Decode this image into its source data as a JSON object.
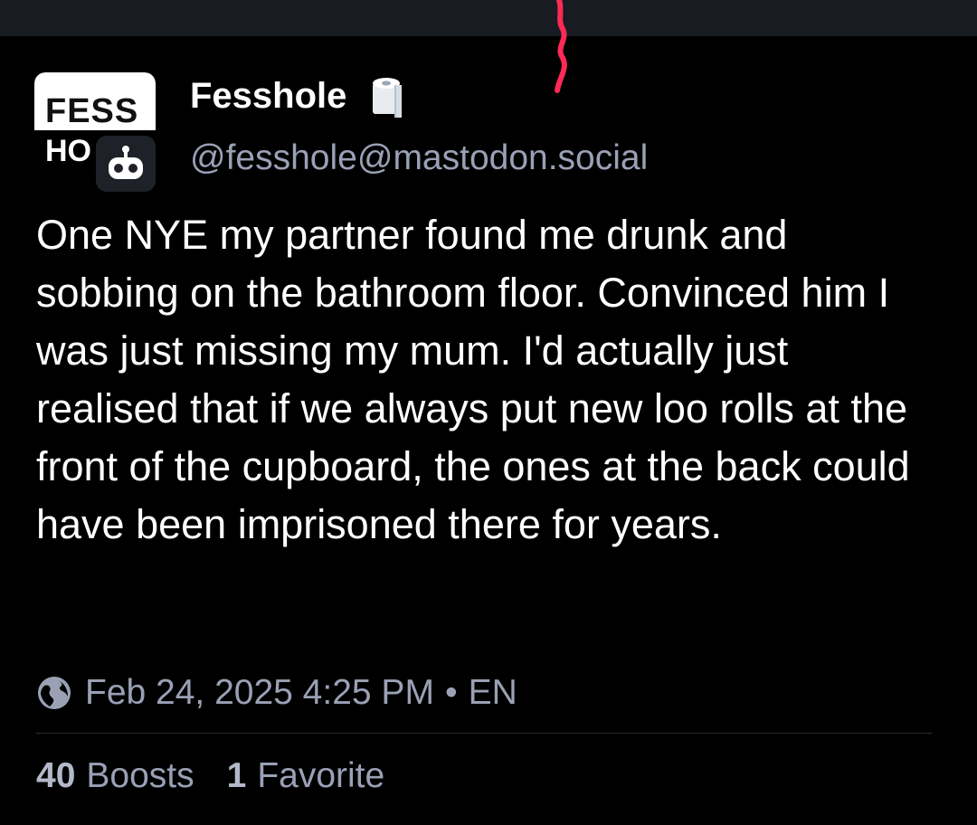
{
  "post": {
    "avatar": {
      "line1": "FESS",
      "line2": "HO",
      "badge_icon": "bot-icon"
    },
    "display_name": "Fesshole",
    "name_emoji_icon": "toilet-roll-icon",
    "handle": "@fesshole@mastodon.social",
    "text": "One NYE my partner found me drunk and sobbing on the bathroom floor. Convinced him I was just missing my mum. I'd actually just realised that if we always put new loo rolls at the front of the cupboard, the ones at the back could have been imprisoned there for years.",
    "visibility_icon": "globe-icon",
    "timestamp": "Feb 24, 2025 4:25 PM",
    "separator": "•",
    "language": "EN",
    "stats": {
      "boosts_count": "40",
      "boosts_label": "Boosts",
      "favorites_count": "1",
      "favorites_label": "Favorite"
    }
  },
  "colors": {
    "background": "#000000",
    "top_bar": "#181b22",
    "primary_text": "#ffffff",
    "secondary_text": "#9aa1b5",
    "scribble": "#ff2a55"
  }
}
